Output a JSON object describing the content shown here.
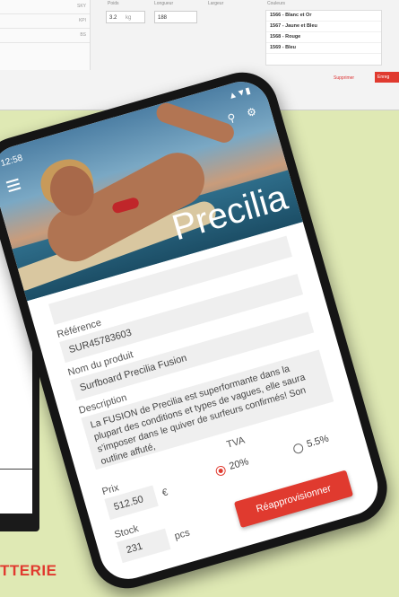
{
  "background_desktop": {
    "col_headers": [
      "Poids",
      "Longueur",
      "Largeur",
      "Couleurs"
    ],
    "poids_value": "3.2",
    "poids_unit": "kg",
    "longueur_value": "188",
    "side_codes": [
      "SKY",
      "KPI",
      "BS"
    ],
    "colors_list": [
      "1566 - Blanc et Or",
      "1567 - Jaune et Bleu",
      "1568 - Rouge",
      "1569 - Bleu"
    ],
    "delete_label": "Supprimer",
    "save_label": "Enreg"
  },
  "background_caption": "TTERIE",
  "phone": {
    "status_time": "12:58",
    "status_icons": "▲▼▮",
    "brand": "Precilia",
    "form": {
      "reference_label": "Référence",
      "reference_value": "SUR45783603",
      "name_label": "Nom du produit",
      "name_value": "Surfboard Precilia Fusion",
      "description_label": "Description",
      "description_value": "La FUSION de Precilia est superformante dans la plupart des conditions et types de vagues, elle saura s'imposer dans le quiver de surfeurs confirmés! Son outline affuté,",
      "tva_label": "TVA",
      "tva_options": [
        "20%",
        "5.5%"
      ],
      "tva_selected": "20%",
      "price_label": "Prix",
      "price_value": "512.50",
      "price_unit": "€",
      "stock_label": "Stock",
      "stock_value": "231",
      "stock_unit": "pcs",
      "restock_button": "Réapprovisionner"
    }
  },
  "colors": {
    "accent": "#e03a2f",
    "background": "#dfe9b4"
  }
}
